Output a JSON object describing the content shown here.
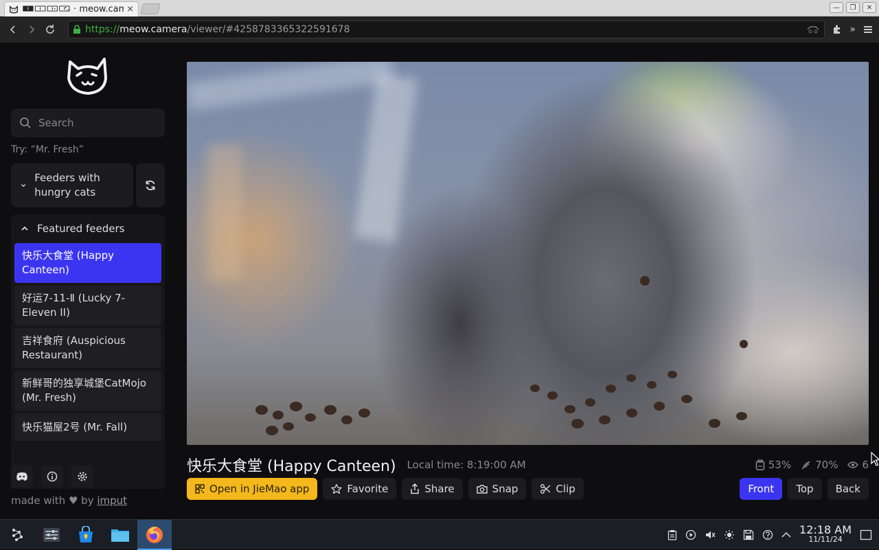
{
  "browser": {
    "tab_title": "🀰🀱🀲🀳 · meow.camera",
    "tab_close": "×",
    "url_scheme": "https://",
    "url_host": "meow.camera",
    "url_path": "/viewer/#4258783365322591678"
  },
  "sidebar": {
    "search_placeholder": "Search",
    "hint": "Try: “Mr. Fresh”",
    "hungry_label": "Feeders with hungry cats",
    "featured_label": "Featured feeders",
    "feeders": [
      {
        "label": "快乐大食堂 (Happy Canteen)",
        "active": true
      },
      {
        "label": "好运7-11-Ⅱ (Lucky 7-Eleven II)",
        "active": false
      },
      {
        "label": "吉祥食府 (Auspicious Restaurant)",
        "active": false
      },
      {
        "label": "新鲜哥的独享城堡CatMojo (Mr. Fresh)",
        "active": false
      },
      {
        "label": "快乐猫屋2号 (Mr. Fall)",
        "active": false
      }
    ],
    "made_with_prefix": "made with",
    "made_with_by": "by",
    "made_with_author": "imput"
  },
  "viewer": {
    "feeder_title": "快乐大食堂 (Happy Canteen)",
    "local_time": "Local time: 8:19:00 AM",
    "stats": {
      "food": "53%",
      "battery": "70%",
      "viewers": "6"
    },
    "actions": {
      "open_app": "Open in JieMao app",
      "favorite": "Favorite",
      "share": "Share",
      "snap": "Snap",
      "clip": "Clip"
    },
    "views": {
      "front": "Front",
      "top": "Top",
      "back": "Back",
      "selected": "Front"
    }
  },
  "taskbar": {
    "time": "12:18 AM",
    "date": "11/11/24"
  },
  "colors": {
    "accent": "#3b35f2",
    "app_button": "#f4b81c",
    "secure_url": "#3cb043"
  }
}
